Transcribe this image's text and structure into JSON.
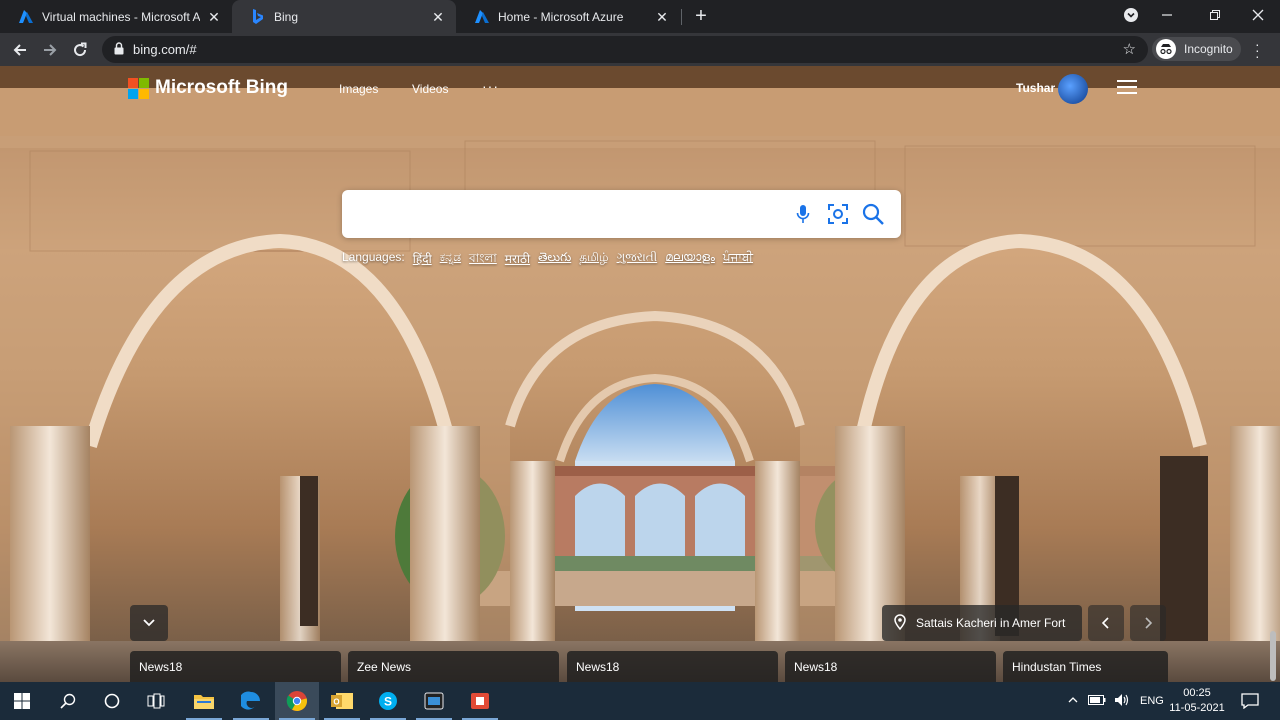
{
  "browser": {
    "tabs": [
      {
        "title": "Virtual machines - Microsoft Azure",
        "icon": "azure-icon",
        "active": false
      },
      {
        "title": "Bing",
        "icon": "bing-icon",
        "active": true
      },
      {
        "title": "Home - Microsoft Azure",
        "icon": "azure-icon",
        "active": false
      }
    ],
    "url": "bing.com/#",
    "profile_label": "Incognito"
  },
  "bing": {
    "logo_text": "Microsoft Bing",
    "nav": {
      "images": "Images",
      "videos": "Videos",
      "more": "···"
    },
    "user_name": "Tushar",
    "search": {
      "value": "",
      "placeholder": ""
    },
    "languages": {
      "label": "Languages:",
      "items": [
        "हिंदी",
        "ಕನ್ನಡ",
        "বাংলা",
        "मराठी",
        "తెలుగు",
        "தமிழ்",
        "ગુજરાતી",
        "മലയാളം",
        "ਪੰਜਾਬੀ"
      ]
    },
    "image_location": "Sattais Kacheri in Amer Fort",
    "news": [
      "News18",
      "Zee News",
      "News18",
      "News18",
      "Hindustan Times"
    ]
  },
  "taskbar": {
    "apps": [
      "windows-start-icon",
      "search-icon",
      "cortana-icon",
      "task-view-icon",
      "file-explorer-icon",
      "edge-icon",
      "chrome-icon",
      "outlook-icon",
      "skype-icon",
      "terminal-icon",
      "recorder-icon"
    ],
    "language": "ENG",
    "time": "00:25",
    "date": "11-05-2021"
  },
  "colors": {
    "chrome_dark": "#202124",
    "chrome_toolbar": "#35363a",
    "taskbar": "#1b2b3a",
    "azure_blue": "#0078d4",
    "bing_teal": "#1a8cff"
  }
}
